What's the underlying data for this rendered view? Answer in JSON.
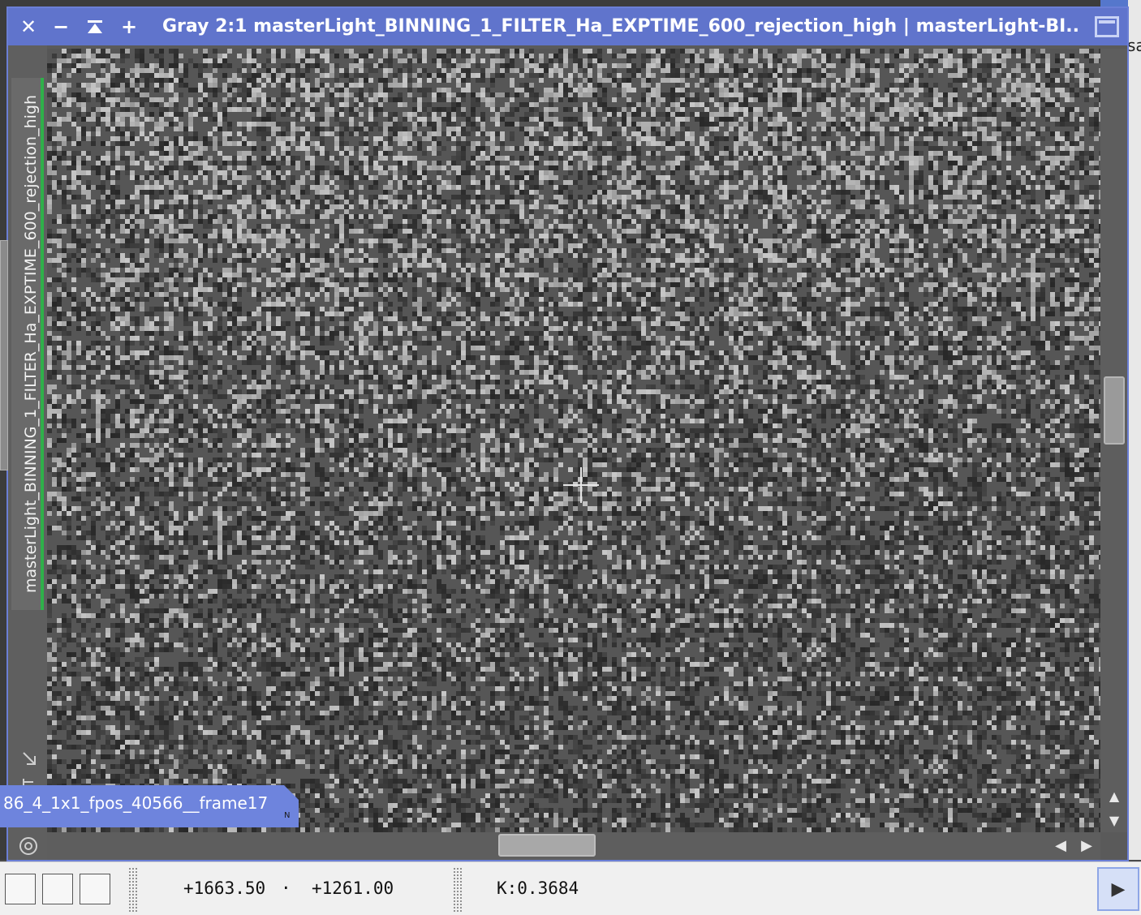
{
  "window": {
    "title": "Gray 2:1 masterLight_BINNING_1_FILTER_Ha_EXPTIME_600_rejection_high | masterLight-BI...",
    "close_icon": "close-icon",
    "minimize_icon": "minimize-icon",
    "shade_icon": "shade-icon",
    "zoom_in_icon": "plus-icon",
    "maximize_icon": "maximize-icon"
  },
  "sidebar": {
    "vertical_tab_label": "masterLight_BINNING_1_FILTER_Ha_EXPTIME_600_rejection_high"
  },
  "floating_tab": {
    "label": "86_4_1x1_fpos_40566__frame17",
    "mark": "N"
  },
  "desktop": {
    "right_edge_text": "sa"
  },
  "statusbar": {
    "coord_x": "+1663.50",
    "separator": "·",
    "coord_y": "+1261.00",
    "value": "K:0.3684"
  },
  "colors": {
    "titlebar": "#6074cc",
    "accent_green": "#2fb04a",
    "floating_tab": "#6e84dd"
  }
}
